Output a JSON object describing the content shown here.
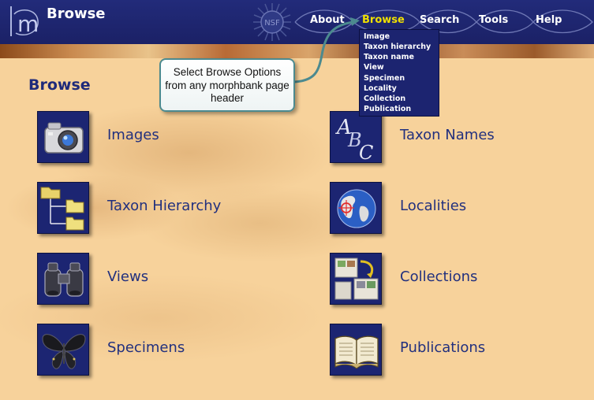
{
  "header": {
    "title": "Browse",
    "logo_letter": "m",
    "seal_text": "NSF",
    "nav": [
      {
        "label": "About",
        "active": false
      },
      {
        "label": "Browse",
        "active": true
      },
      {
        "label": "Search",
        "active": false
      },
      {
        "label": "Tools",
        "active": false
      },
      {
        "label": "Help",
        "active": false
      }
    ]
  },
  "dropdown": {
    "items": [
      "Image",
      "Taxon hierarchy",
      "Taxon name",
      "View",
      "Specimen",
      "Locality",
      "Collection",
      "Publication"
    ]
  },
  "callout": {
    "text": "Select Browse Options from any morphbank page header"
  },
  "main": {
    "heading": "Browse",
    "items": [
      {
        "label": "Images",
        "icon": "camera-icon"
      },
      {
        "label": "Taxon Names",
        "icon": "abc-letters-icon"
      },
      {
        "label": "Taxon Hierarchy",
        "icon": "folder-tree-icon"
      },
      {
        "label": "Localities",
        "icon": "globe-icon"
      },
      {
        "label": "Views",
        "icon": "binoculars-icon"
      },
      {
        "label": "Collections",
        "icon": "collection-icon"
      },
      {
        "label": "Specimens",
        "icon": "butterfly-icon"
      },
      {
        "label": "Publications",
        "icon": "book-icon"
      }
    ]
  },
  "colors": {
    "header_bg": "#1c2470",
    "active_nav": "#f0e000",
    "link_text": "#22307e",
    "content_bg": "#f7d29b"
  }
}
